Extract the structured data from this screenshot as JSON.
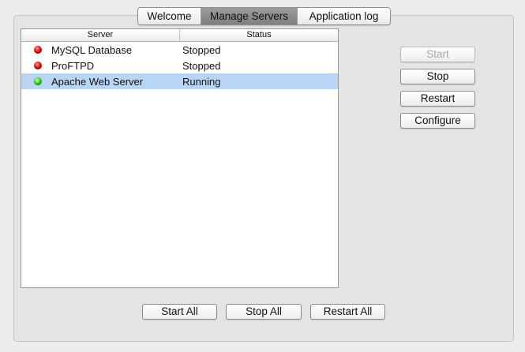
{
  "tabs": [
    {
      "label": "Welcome",
      "selected": false
    },
    {
      "label": "Manage Servers",
      "selected": true
    },
    {
      "label": "Application log",
      "selected": false
    }
  ],
  "table": {
    "columns": [
      "Server",
      "Status"
    ],
    "rows": [
      {
        "server": "MySQL Database",
        "status": "Stopped",
        "indicator": "red",
        "selected": false
      },
      {
        "server": "ProFTPD",
        "status": "Stopped",
        "indicator": "red",
        "selected": false
      },
      {
        "server": "Apache Web Server",
        "status": "Running",
        "indicator": "green",
        "selected": true
      }
    ]
  },
  "side_buttons": {
    "start": {
      "label": "Start",
      "enabled": false
    },
    "stop": {
      "label": "Stop",
      "enabled": true
    },
    "restart": {
      "label": "Restart",
      "enabled": true
    },
    "configure": {
      "label": "Configure",
      "enabled": true
    }
  },
  "bottom_buttons": {
    "start_all": "Start All",
    "stop_all": "Stop All",
    "restart_all": "Restart All"
  },
  "colors": {
    "selection": "#b9d5f5",
    "stopped": "#e01010",
    "running": "#3fce1f"
  }
}
